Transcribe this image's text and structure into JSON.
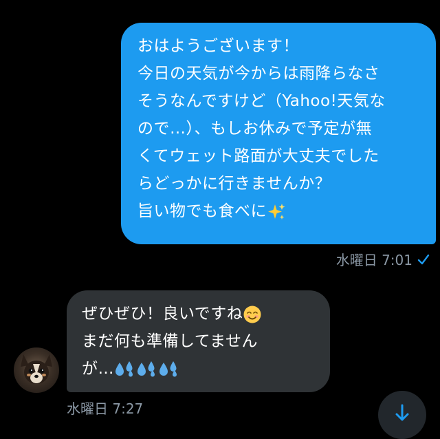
{
  "messages": {
    "outgoing": {
      "lines": [
        "おはようございます！",
        "今日の天気が今からは雨降らなさ",
        "そうなんですけど（Yahoo!天気な",
        "ので…）、もしお休みで予定が無",
        "くてウェット路面が大丈夫でした",
        "らどっかに行きませんか？",
        "旨い物でも食べに"
      ],
      "time": "水曜日 7:01",
      "status_icon": "check-icon"
    },
    "incoming": {
      "lines": [
        "ぜひぜひ！良いですね",
        "まだ何も準備してません",
        "が…"
      ],
      "time": "水曜日 7:27",
      "avatar_icon": "dog-avatar"
    }
  },
  "emoji": {
    "sparkles": "sparkles-emoji",
    "smile": "smiling-face-emoji",
    "sweat": "sweat-droplets-emoji"
  },
  "colors": {
    "outgoing_bubble": "#1d9bf0",
    "incoming_bubble": "#2f3336",
    "meta_text": "#8b98a5",
    "background": "#000000"
  },
  "scroll_button": {
    "icon": "arrow-down-icon"
  }
}
